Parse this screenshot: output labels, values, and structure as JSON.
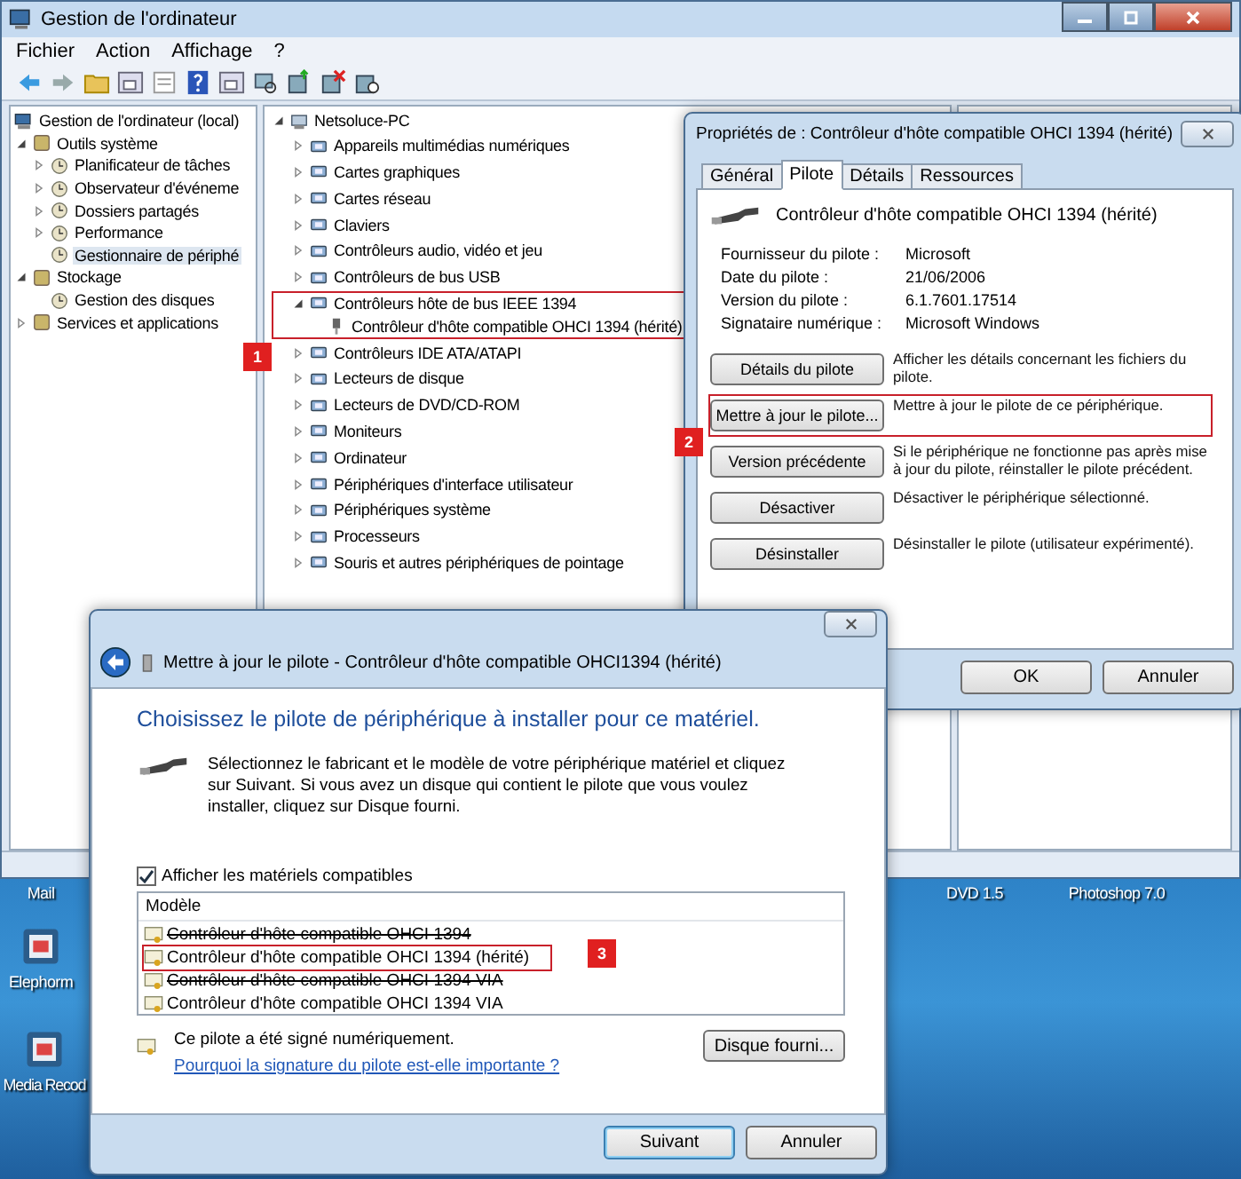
{
  "desktop": {
    "icons": [
      {
        "label": "Mail"
      },
      {
        "label": "Elephorm"
      },
      {
        "label": "Media Recod"
      },
      {
        "label": "DVD 1.5"
      },
      {
        "label": "Photoshop 7.0"
      }
    ]
  },
  "main_window": {
    "title": "Gestion de l'ordinateur",
    "menu": [
      "Fichier",
      "Action",
      "Affichage",
      "?"
    ],
    "left_tree": [
      {
        "label": "Gestion de l'ordinateur (local)",
        "selected": false,
        "children": [
          {
            "label": "Outils système",
            "expanded": true,
            "selected": false,
            "children": [
              {
                "label": "Planificateur de tâches",
                "expanded": false,
                "selected": false
              },
              {
                "label": "Observateur d'événeme",
                "expanded": false,
                "selected": false
              },
              {
                "label": "Dossiers partagés",
                "expanded": false,
                "selected": false
              },
              {
                "label": "Performance",
                "expanded": false,
                "selected": false
              },
              {
                "label": "Gestionnaire de périphé",
                "selected": true
              }
            ]
          },
          {
            "label": "Stockage",
            "expanded": true,
            "selected": false,
            "children": [
              {
                "label": "Gestion des disques",
                "selected": false
              }
            ]
          },
          {
            "label": "Services et applications",
            "expanded": false,
            "selected": false
          }
        ]
      }
    ],
    "device_tree": [
      {
        "label": "Netsoluce-PC",
        "expanded": true,
        "children": [
          {
            "label": "Appareils multimédias numériques",
            "expanded": false,
            "outlined": false
          },
          {
            "label": "Cartes graphiques",
            "expanded": false,
            "outlined": false
          },
          {
            "label": "Cartes réseau",
            "expanded": false,
            "outlined": false
          },
          {
            "label": "Claviers",
            "expanded": false,
            "outlined": false
          },
          {
            "label": "Contrôleurs audio, vidéo et jeu",
            "expanded": false,
            "outlined": false
          },
          {
            "label": "Contrôleurs de bus USB",
            "expanded": false,
            "outlined": false
          },
          {
            "label": "Contrôleurs hôte de bus IEEE 1394",
            "expanded": true,
            "outlined": true,
            "children": [
              {
                "label": "Contrôleur d'hôte compatible OHCI 1394 (hérité)"
              }
            ]
          },
          {
            "label": "Contrôleurs IDE ATA/ATAPI",
            "expanded": false,
            "outlined": false
          },
          {
            "label": "Lecteurs de disque",
            "expanded": false,
            "outlined": false
          },
          {
            "label": "Lecteurs de DVD/CD-ROM",
            "expanded": false,
            "outlined": false
          },
          {
            "label": "Moniteurs",
            "expanded": false,
            "outlined": false
          },
          {
            "label": "Ordinateur",
            "expanded": false,
            "outlined": false
          },
          {
            "label": "Périphériques d'interface utilisateur",
            "expanded": false,
            "outlined": false
          },
          {
            "label": "Périphériques système",
            "expanded": false,
            "outlined": false
          },
          {
            "label": "Processeurs",
            "expanded": false,
            "outlined": false
          },
          {
            "label": "Souris et autres périphériques de pointage",
            "expanded": false,
            "outlined": false
          }
        ]
      }
    ]
  },
  "properties_dialog": {
    "title": "Propriétés de : Contrôleur d'hôte compatible OHCI 1394 (hérité)",
    "tabs": [
      {
        "label": "Général",
        "selected": false
      },
      {
        "label": "Pilote",
        "selected": true
      },
      {
        "label": "Détails",
        "selected": false
      },
      {
        "label": "Ressources",
        "selected": false
      }
    ],
    "device_name": "Contrôleur d'hôte compatible OHCI 1394 (hérité)",
    "info": [
      {
        "label": "Fournisseur du pilote :",
        "value": "Microsoft"
      },
      {
        "label": "Date du pilote :",
        "value": "21/06/2006"
      },
      {
        "label": "Version du pilote :",
        "value": "6.1.7601.17514"
      },
      {
        "label": "Signataire numérique :",
        "value": "Microsoft Windows"
      }
    ],
    "actions": [
      {
        "button": "Détails du pilote",
        "description": "Afficher les détails concernant les fichiers du pilote.",
        "outlined": false
      },
      {
        "button": "Mettre à jour le pilote...",
        "description": "Mettre à jour le pilote de ce périphérique.",
        "outlined": true
      },
      {
        "button": "Version précédente",
        "description": "Si le périphérique ne fonctionne pas après mise à jour du pilote, réinstaller le pilote précédent.",
        "outlined": false
      },
      {
        "button": "Désactiver",
        "description": "Désactiver le périphérique sélectionné.",
        "outlined": false
      },
      {
        "button": "Désinstaller",
        "description": "Désinstaller le pilote (utilisateur expérimenté).",
        "outlined": false
      }
    ],
    "buttons": [
      "OK",
      "Annuler"
    ]
  },
  "update_wizard": {
    "title": "Mettre à jour le pilote - Contrôleur d'hôte compatible OHCI1394 (hérité)",
    "heading": "Choisissez le pilote de périphérique à installer pour ce matériel.",
    "instructions": "Sélectionnez le fabricant et le modèle de votre périphérique matériel et cliquez sur Suivant. Si vous avez un disque qui contient le pilote que vous voulez installer, cliquez sur Disque fourni.",
    "show_compatible": {
      "label": "Afficher les matériels compatibles",
      "checked": true
    },
    "model_list": {
      "header": "Modèle",
      "items": [
        {
          "label": "Contrôleur d'hôte compatible OHCI 1394",
          "struck": true,
          "outlined": false
        },
        {
          "label": "Contrôleur d'hôte compatible OHCI 1394 (hérité)",
          "struck": false,
          "outlined": true
        },
        {
          "label": "Contrôleur d'hôte compatible OHCI 1394 VIA",
          "struck": true,
          "outlined": false
        },
        {
          "label": "Contrôleur d'hôte compatible OHCI 1394 VIA",
          "struck": false,
          "outlined": false
        }
      ]
    },
    "signed_note": "Ce pilote a été signé numériquement.",
    "signature_link": "Pourquoi la signature du pilote est-elle importante ?",
    "have_disk_button": "Disque fourni...",
    "buttons": [
      {
        "label": "Suivant",
        "default": true
      },
      {
        "label": "Annuler",
        "default": false
      }
    ]
  },
  "annotations": [
    {
      "label": "1"
    },
    {
      "label": "2"
    },
    {
      "label": "3"
    }
  ]
}
